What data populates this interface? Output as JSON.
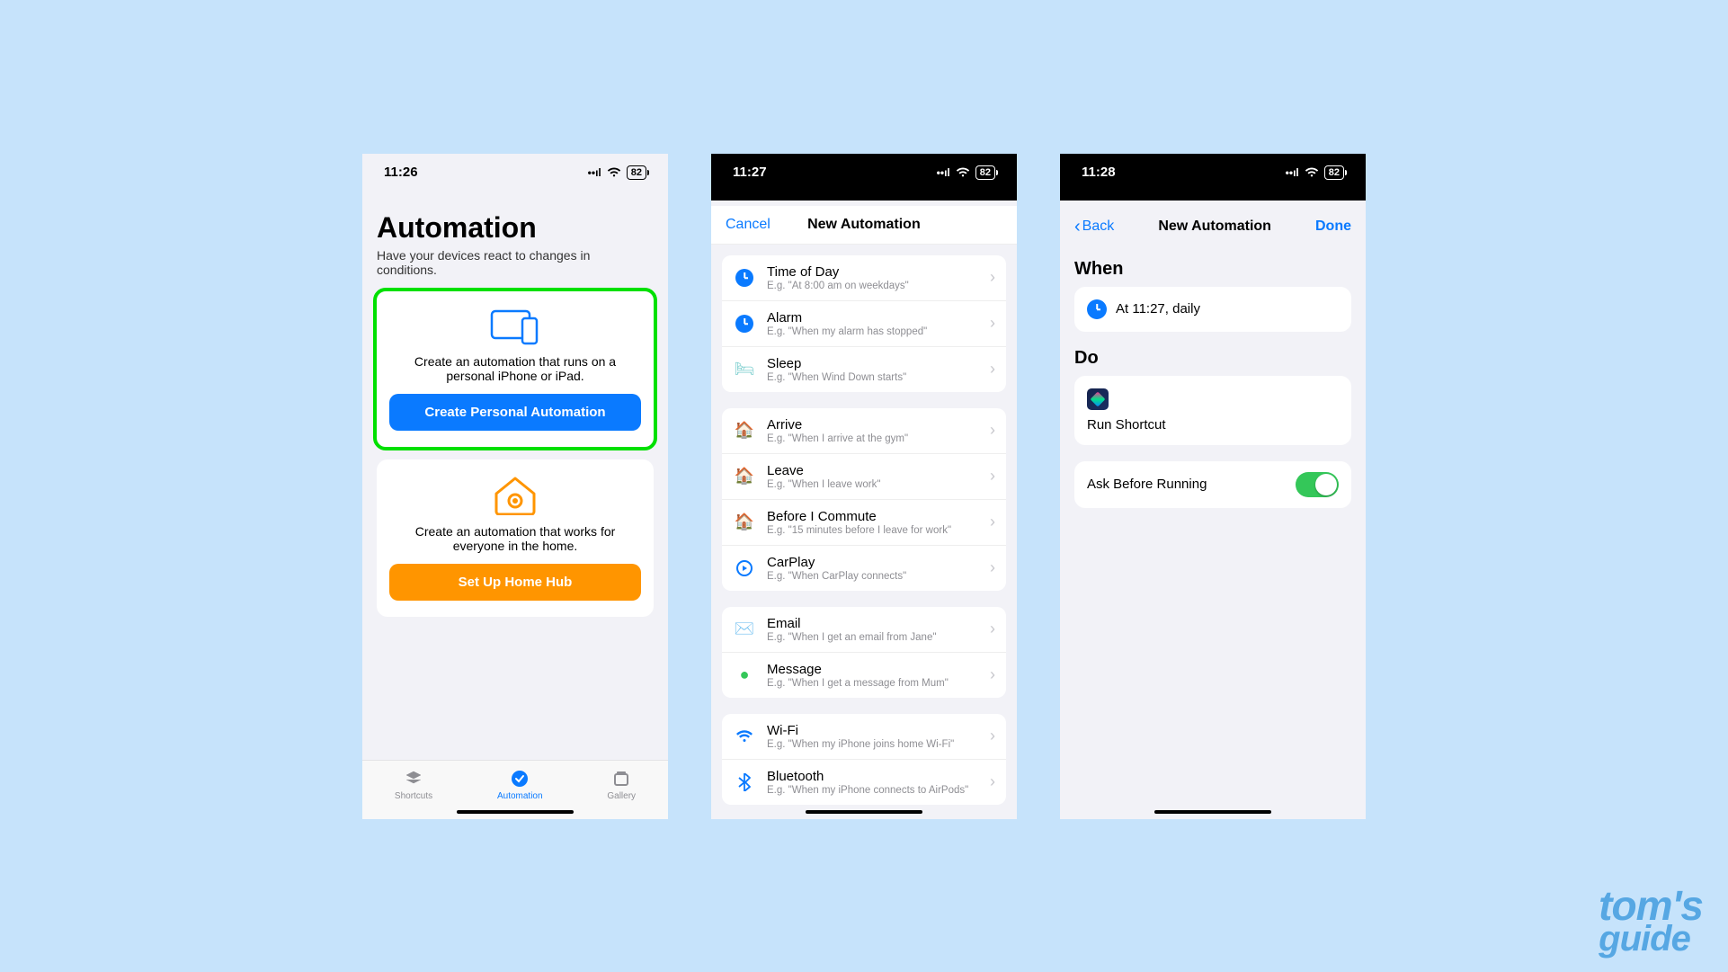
{
  "watermark": {
    "line1": "tom's",
    "line2": "guide"
  },
  "phone1": {
    "status": {
      "time": "11:26",
      "battery": "82"
    },
    "title": "Automation",
    "subtitle": "Have your devices react to changes in conditions.",
    "personal": {
      "desc": "Create an automation that runs on a personal iPhone or iPad.",
      "button": "Create Personal Automation"
    },
    "home": {
      "desc": "Create an automation that works for everyone in the home.",
      "button": "Set Up Home Hub"
    },
    "tabs": {
      "shortcuts": "Shortcuts",
      "automation": "Automation",
      "gallery": "Gallery"
    }
  },
  "phone2": {
    "status": {
      "time": "11:27",
      "battery": "82"
    },
    "header": {
      "cancel": "Cancel",
      "title": "New Automation"
    },
    "group1": [
      {
        "icon": "clock",
        "title": "Time of Day",
        "sub": "E.g. \"At 8:00 am on weekdays\""
      },
      {
        "icon": "alarm",
        "title": "Alarm",
        "sub": "E.g. \"When my alarm has stopped\""
      },
      {
        "icon": "bed",
        "title": "Sleep",
        "sub": "E.g. \"When Wind Down starts\""
      }
    ],
    "group2": [
      {
        "icon": "arrive",
        "title": "Arrive",
        "sub": "E.g. \"When I arrive at the gym\""
      },
      {
        "icon": "leave",
        "title": "Leave",
        "sub": "E.g. \"When I leave work\""
      },
      {
        "icon": "commute",
        "title": "Before I Commute",
        "sub": "E.g. \"15 minutes before I leave for work\""
      },
      {
        "icon": "carplay",
        "title": "CarPlay",
        "sub": "E.g. \"When CarPlay connects\""
      }
    ],
    "group3": [
      {
        "icon": "email",
        "title": "Email",
        "sub": "E.g. \"When I get an email from Jane\""
      },
      {
        "icon": "message",
        "title": "Message",
        "sub": "E.g. \"When I get a message from Mum\""
      }
    ],
    "group4": [
      {
        "icon": "wifi",
        "title": "Wi-Fi",
        "sub": "E.g. \"When my iPhone joins home Wi-Fi\""
      },
      {
        "icon": "bluetooth",
        "title": "Bluetooth",
        "sub": "E.g. \"When my iPhone connects to AirPods\""
      }
    ]
  },
  "phone3": {
    "status": {
      "time": "11:28",
      "battery": "82"
    },
    "nav": {
      "back": "Back",
      "title": "New Automation",
      "done": "Done"
    },
    "when": {
      "header": "When",
      "text": "At 11:27, daily"
    },
    "do": {
      "header": "Do",
      "text": "Run Shortcut"
    },
    "ask": {
      "label": "Ask Before Running",
      "value": true
    }
  }
}
